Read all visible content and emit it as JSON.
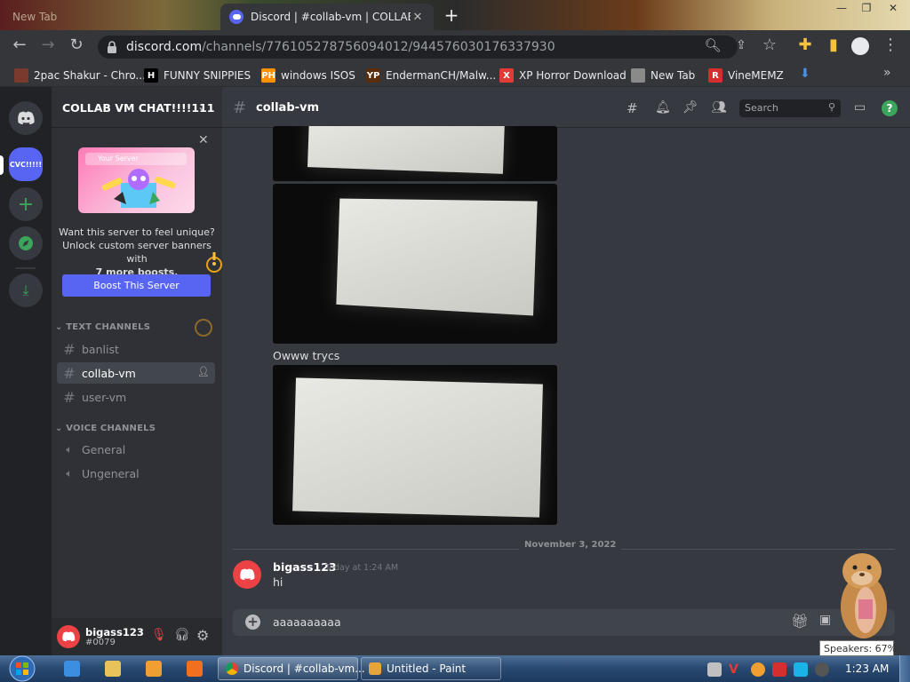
{
  "browser": {
    "inactive_tab_title": "New Tab",
    "active_tab_title": "Discord | #collab-vm | COLLAB V",
    "url_host": "discord.com",
    "url_path": "/channels/776105278756094012/944576030176337930"
  },
  "bookmarks": [
    {
      "label": "2pac Shakur - Chro...",
      "icon": "2pac-favicon",
      "color": "#7a3b2e"
    },
    {
      "label": "FUNNY SNIPPIES",
      "icon": "H",
      "color": "#000000"
    },
    {
      "label": "windows ISOS",
      "icon": "PH",
      "color": "#ff9000"
    },
    {
      "label": "EndermanCH/Malw...",
      "icon": "YP",
      "color": "#5a2d0c"
    },
    {
      "label": "XP Horror Download",
      "icon": "X",
      "color": "#e53935"
    },
    {
      "label": "New Tab",
      "icon": "avatar",
      "color": "#8a8a8a"
    },
    {
      "label": "VineMEMZ",
      "icon": "R",
      "color": "#d32f2f"
    }
  ],
  "server": {
    "name": "COLLAB VM CHAT!!!!111",
    "icon_label": "CVC!!!!!",
    "promo_banner_label": "Your Server",
    "promo_line1": "Want this server to feel unique?",
    "promo_line2": "Unlock custom server banners with",
    "promo_line3": "7 more boosts.",
    "boost_button": "Boost This Server"
  },
  "text_channels_label": "TEXT CHANNELS",
  "text_channels": [
    "banlist",
    "collab-vm",
    "user-vm"
  ],
  "voice_channels_label": "VOICE CHANNELS",
  "voice_channels": [
    "General",
    "Ungeneral"
  ],
  "user": {
    "name": "bigass123",
    "tag": "#0079"
  },
  "chat": {
    "channel": "collab-vm",
    "search_placeholder": "Search",
    "caption": "Owww trycs",
    "date_divider": "November 3, 2022",
    "message": {
      "author": "bigass123",
      "timestamp": "Today at 1:24 AM",
      "text": "hi"
    },
    "draft": "aaaaaaaaaa"
  },
  "taskbar": {
    "items": [
      "Discord | #collab-vm...",
      "Untitled - Paint"
    ],
    "clock": "1:23 AM",
    "tooltip": "Speakers: 67%"
  },
  "colors": {
    "blurple": "#5865f2",
    "green": "#3ba55c",
    "red": "#ed4245"
  }
}
